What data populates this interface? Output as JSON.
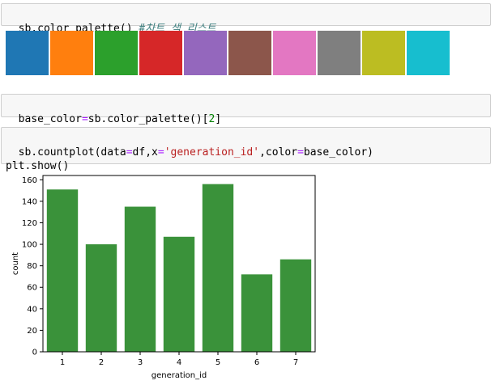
{
  "cells": [
    {
      "parts": [
        {
          "text": "sb.color_palette() ",
          "cls": ""
        },
        {
          "text": "#차트 색 리스트",
          "cls": "cmt"
        }
      ]
    },
    {
      "parts": [
        {
          "text": "base_color",
          "cls": ""
        },
        {
          "text": "=",
          "cls": "kw-op"
        },
        {
          "text": "sb.color_palette()[",
          "cls": ""
        },
        {
          "text": "2",
          "cls": "num"
        },
        {
          "text": "]",
          "cls": ""
        }
      ]
    },
    {
      "parts": [
        {
          "text": "sb.countplot(data",
          "cls": ""
        },
        {
          "text": "=",
          "cls": "kw-op"
        },
        {
          "text": "df,x",
          "cls": ""
        },
        {
          "text": "=",
          "cls": "kw-op"
        },
        {
          "text": "'generation_id'",
          "cls": "str"
        },
        {
          "text": ",color",
          "cls": ""
        },
        {
          "text": "=",
          "cls": "kw-op"
        },
        {
          "text": "base_color)\nplt.show()",
          "cls": ""
        }
      ]
    }
  ],
  "palette": {
    "colors": [
      "#1f77b4",
      "#ff7f0e",
      "#2ca02c",
      "#d62728",
      "#9467bd",
      "#8c564b",
      "#e377c2",
      "#7f7f7f",
      "#bcbd22",
      "#17becf"
    ]
  },
  "chart_data": {
    "type": "bar",
    "categories": [
      "1",
      "2",
      "3",
      "4",
      "5",
      "6",
      "7"
    ],
    "values": [
      151,
      100,
      135,
      107,
      156,
      72,
      86
    ],
    "xlabel": "generation_id",
    "ylabel": "count",
    "ylim": [
      0,
      164
    ],
    "yticks": [
      0,
      20,
      40,
      60,
      80,
      100,
      120,
      140,
      160
    ],
    "bar_color": "#3a923a",
    "grid": false
  }
}
